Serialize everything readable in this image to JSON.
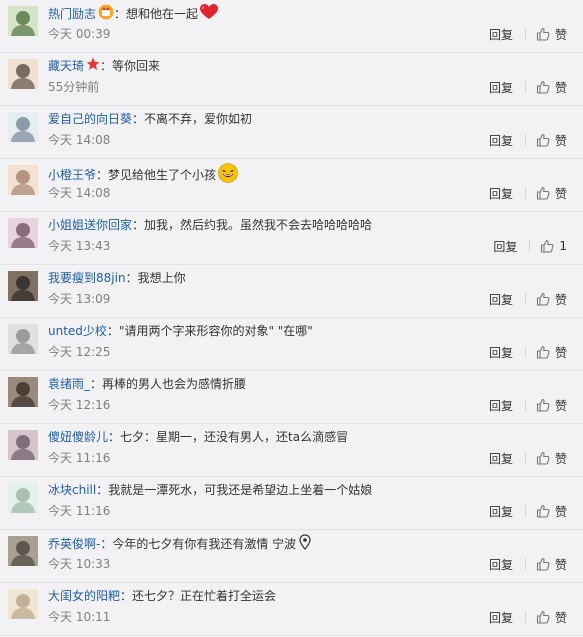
{
  "comments": [
    {
      "user": "热门励志",
      "user_color": "#1f5ea8",
      "badge": "vip-icon",
      "sep": "：",
      "text": "想和他在一起",
      "emoji": "heart-icon",
      "time": "今天 00:39",
      "reply": "回复",
      "like": "赞",
      "avatar": "#6a8a5a"
    },
    {
      "user": "藏天琦",
      "user_color": "#1f5ea8",
      "badge": "star-icon",
      "sep": "：",
      "text": "等你回来",
      "emoji": "",
      "time": "55分钟前",
      "reply": "回复",
      "like": "赞",
      "avatar": "#7a6a60"
    },
    {
      "user": "爱自己的向日葵",
      "user_color": "#1f5ea8",
      "badge": "",
      "sep": "：",
      "text": "不离不弃，爱你如初",
      "emoji": "",
      "time": "今天 14:08",
      "reply": "回复",
      "like": "赞",
      "avatar": "#8d9aa8"
    },
    {
      "user": "小橙王爷",
      "user_color": "#1f5ea8",
      "badge": "",
      "sep": "：",
      "text": "梦见给他生了个小孩",
      "emoji": "laugh-icon",
      "time": "今天 14:08",
      "reply": "回复",
      "like": "赞",
      "avatar": "#b59580"
    },
    {
      "user": "小姐姐送你回家",
      "user_color": "#1f5ea8",
      "badge": "",
      "sep": "：",
      "text": "加我，然后约我。虽然我不会去哈哈哈哈哈",
      "emoji": "",
      "time": "今天 13:43",
      "reply": "回复",
      "like": "1",
      "avatar": "#8a6c7c"
    },
    {
      "user": "我要瘦到88jin",
      "user_color": "#1f5ea8",
      "badge": "",
      "sep": "：",
      "text": "我想上你",
      "emoji": "",
      "time": "今天 13:09",
      "reply": "回复",
      "like": "赞",
      "avatar": "#3a3530"
    },
    {
      "user": "unted少校",
      "user_color": "#1f5ea8",
      "badge": "",
      "sep": "：",
      "text": "\"请用两个字来形容你的对象\" \"在哪\"",
      "emoji": "",
      "time": "今天 12:25",
      "reply": "回复",
      "like": "赞",
      "avatar": "#9a9a9a"
    },
    {
      "user": "袁绪雨_",
      "user_color": "#1f5ea8",
      "badge": "",
      "sep": "：",
      "text": "再棒的男人也会为感情折腰",
      "emoji": "",
      "time": "今天 12:16",
      "reply": "回复",
      "like": "赞",
      "avatar": "#4a4038"
    },
    {
      "user": "傻妞傻龄儿",
      "user_color": "#1f5ea8",
      "badge": "",
      "sep": "：",
      "text": "七夕：星期一，还没有男人，还ta么滴感冒",
      "emoji": "",
      "time": "今天 11:16",
      "reply": "回复",
      "like": "赞",
      "avatar": "#7e6e78"
    },
    {
      "user": "冰块chill",
      "user_color": "#1f5ea8",
      "badge": "",
      "sep": "：",
      "text": "我就是一潭死水，可我还是希望边上坐着一个姑娘",
      "emoji": "",
      "time": "今天 11:16",
      "reply": "回复",
      "like": "赞",
      "avatar": "#a8c0b0"
    },
    {
      "user": "乔英俊啊-",
      "user_color": "#1f5ea8",
      "badge": "",
      "sep": "：",
      "text": "今年的七夕有你有我还有激情 宁波",
      "emoji": "pin-icon",
      "time": "今天 10:33",
      "reply": "回复",
      "like": "赞",
      "avatar": "#5c5850"
    },
    {
      "user": "大闺女的阳粑",
      "user_color": "#1f5ea8",
      "badge": "",
      "sep": "：",
      "text": "还七夕？正在忙着打全运会",
      "emoji": "",
      "time": "今天 10:11",
      "reply": "回复",
      "like": "赞",
      "avatar": "#c4b098"
    }
  ]
}
